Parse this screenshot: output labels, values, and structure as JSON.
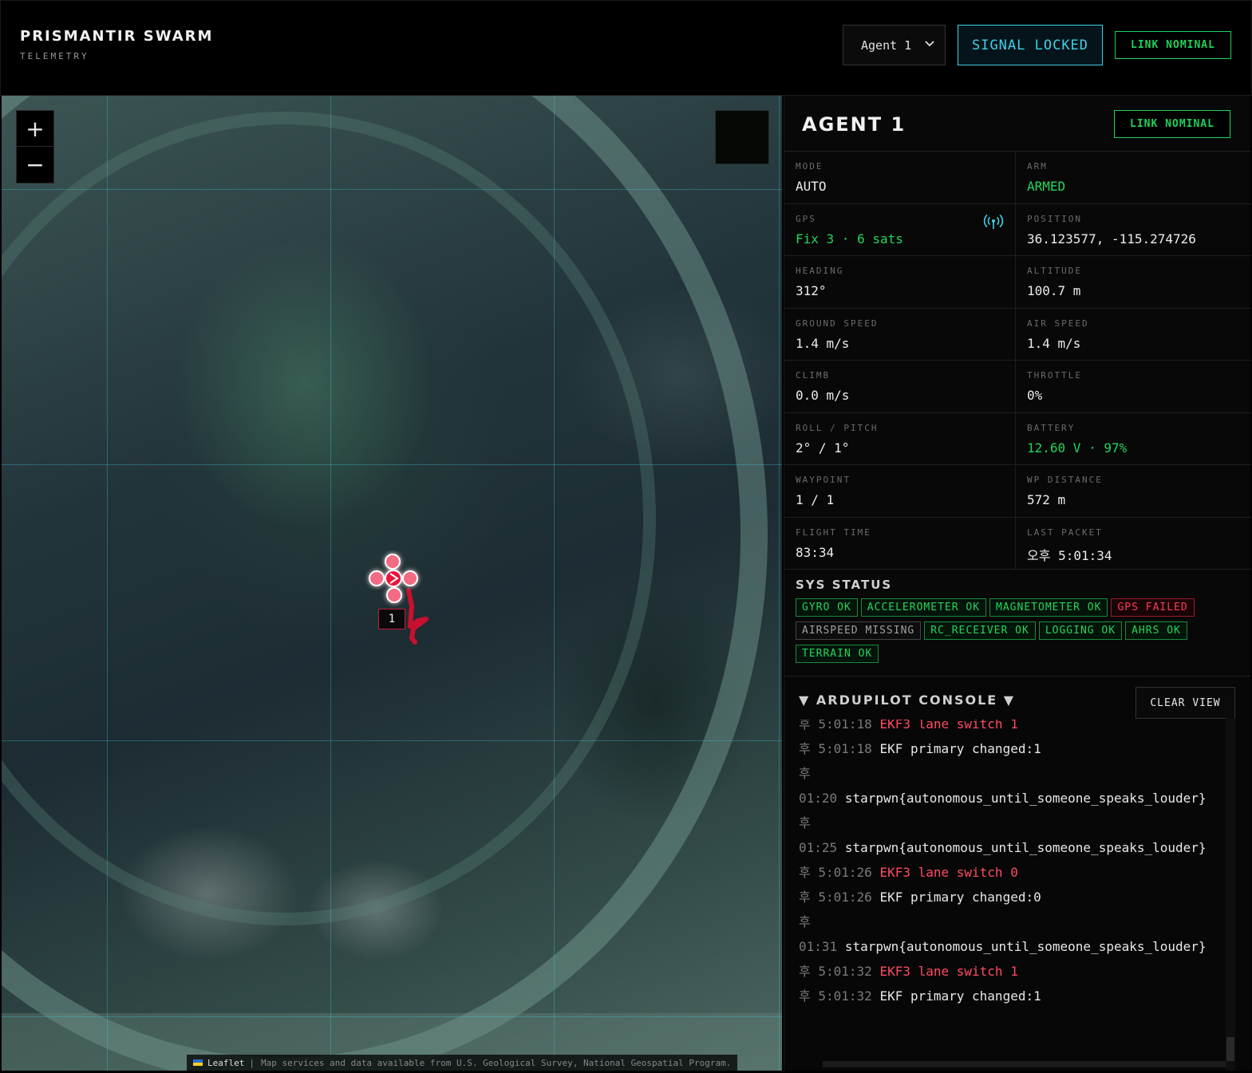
{
  "header": {
    "title": "PRISMANTIR SWARM",
    "subtitle": "TELEMETRY",
    "agent_select": "Agent 1",
    "signal_button": "SIGNAL LOCKED",
    "link_status": "LINK NOMINAL"
  },
  "map": {
    "zoom_in": "+",
    "zoom_out": "−",
    "drone_label": "1",
    "attribution_leaflet": "Leaflet",
    "attribution_separator": "|",
    "attribution_text": "Map services and data available from U.S. Geological Survey, National Geospatial Program."
  },
  "panel": {
    "agent_title": "AGENT 1",
    "link_status": "LINK NOMINAL",
    "telemetry": [
      {
        "label": "MODE",
        "value": "AUTO"
      },
      {
        "label": "ARM",
        "value": "ARMED"
      },
      {
        "label": "GPS",
        "value": "Fix 3 · 6 sats"
      },
      {
        "label": "POSITION",
        "value": "36.123577, -115.274726"
      },
      {
        "label": "HEADING",
        "value": "312°"
      },
      {
        "label": "ALTITUDE",
        "value": "100.7 m"
      },
      {
        "label": "GROUND SPEED",
        "value": "1.4 m/s"
      },
      {
        "label": "AIR SPEED",
        "value": "1.4 m/s"
      },
      {
        "label": "CLIMB",
        "value": "0.0 m/s"
      },
      {
        "label": "THROTTLE",
        "value": "0%"
      },
      {
        "label": "ROLL / PITCH",
        "value": "2° / 1°"
      },
      {
        "label": "BATTERY",
        "value": "12.60 V · 97%"
      },
      {
        "label": "WAYPOINT",
        "value": "1 / 1"
      },
      {
        "label": "WP DISTANCE",
        "value": "572 m"
      },
      {
        "label": "FLIGHT TIME",
        "value": "83:34"
      },
      {
        "label": "LAST PACKET",
        "value": "오후 5:01:34"
      }
    ],
    "sys_status": {
      "title": "SYS STATUS",
      "badges": [
        {
          "text": "GYRO OK",
          "status": "ok"
        },
        {
          "text": "ACCELEROMETER OK",
          "status": "ok"
        },
        {
          "text": "MAGNETOMETER OK",
          "status": "ok"
        },
        {
          "text": "GPS FAILED",
          "status": "fail"
        },
        {
          "text": "AIRSPEED MISSING",
          "status": "missing"
        },
        {
          "text": "RC_RECEIVER OK",
          "status": "ok"
        },
        {
          "text": "LOGGING OK",
          "status": "ok"
        },
        {
          "text": "AHRS OK",
          "status": "ok"
        },
        {
          "text": "TERRAIN OK",
          "status": "ok"
        }
      ]
    },
    "console": {
      "title": "▼ ARDUPILOT CONSOLE ▼",
      "clear_button": "CLEAR VIEW",
      "lines": [
        {
          "ts": "후 5:01:18",
          "msg": "EKF3 lane switch 1",
          "kind": "warn"
        },
        {
          "ts": "후 5:01:18",
          "msg": "EKF primary changed:1",
          "kind": "info"
        },
        {
          "ts": "후",
          "msg": "",
          "kind": "info"
        },
        {
          "ts": "01:20",
          "msg": "starpwn{autonomous_until_someone_speaks_louder}",
          "kind": "info"
        },
        {
          "ts": "후",
          "msg": "",
          "kind": "info"
        },
        {
          "ts": "01:25",
          "msg": "starpwn{autonomous_until_someone_speaks_louder}",
          "kind": "info"
        },
        {
          "ts": "후 5:01:26",
          "msg": "EKF3 lane switch 0",
          "kind": "warn"
        },
        {
          "ts": "후 5:01:26",
          "msg": "EKF primary changed:0",
          "kind": "info"
        },
        {
          "ts": "후",
          "msg": "",
          "kind": "info"
        },
        {
          "ts": "01:31",
          "msg": "starpwn{autonomous_until_someone_speaks_louder}",
          "kind": "info"
        },
        {
          "ts": "후 5:01:32",
          "msg": "EKF3 lane switch 1",
          "kind": "warn"
        },
        {
          "ts": "후 5:01:32",
          "msg": "EKF primary changed:1",
          "kind": "info"
        }
      ]
    }
  },
  "colors": {
    "accent_cyan": "#3fd0e8",
    "ok_green": "#22d65a",
    "fail_red": "#ff3b55",
    "drone_red": "#e8173c"
  }
}
